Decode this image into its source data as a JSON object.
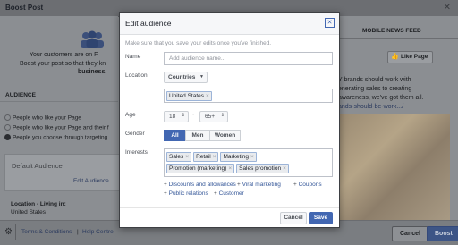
{
  "background": {
    "title": "Boost Post",
    "left": {
      "line1": "Your customers are on F",
      "line2": "Boost your post so that they kn",
      "line3": "business.",
      "audience_header": "AUDIENCE",
      "options": [
        "People who like your Page",
        "People who like your Page and their f",
        "People you choose through targeting"
      ],
      "default_audience": "Default Audience",
      "edit_audience": "Edit Audience",
      "location_label": "Location - Living in:",
      "location_value": "United States"
    },
    "right": {
      "tab": "MOBILE NEWS FEED",
      "like_page": "Like Page",
      "text1": "Y brands should work with",
      "text2": "enerating sales to creating",
      "text3": "awareness, we've got them all.",
      "text4": "ands-should-be-work.../"
    },
    "footer": {
      "terms": "Terms & Conditions",
      "separator": "|",
      "help": "Help Centre",
      "cancel": "Cancel",
      "boost": "Boost"
    }
  },
  "modal": {
    "title": "Edit audience",
    "note": "Make sure that you save your edits once you've finished.",
    "name_label": "Name",
    "name_placeholder": "Add audience name...",
    "location_label": "Location",
    "countries": "Countries",
    "location_tag": "United States",
    "age_label": "Age",
    "age_min": "18",
    "age_dash": "-",
    "age_max": "65+",
    "gender_label": "Gender",
    "gender_options": [
      "All",
      "Men",
      "Women"
    ],
    "gender_selected": "All",
    "interests_label": "Interests",
    "interest_tags": [
      "Sales",
      "Retail",
      "Marketing",
      "Promotion (marketing)",
      "Sales promotion"
    ],
    "suggestions": [
      "Discounts and allowances",
      "Viral marketing",
      "Coupons",
      "Public relations",
      "Customer"
    ],
    "cancel": "Cancel",
    "save": "Save"
  },
  "colors": {
    "accent": "#4267b2",
    "overlay": "#8f9296"
  }
}
